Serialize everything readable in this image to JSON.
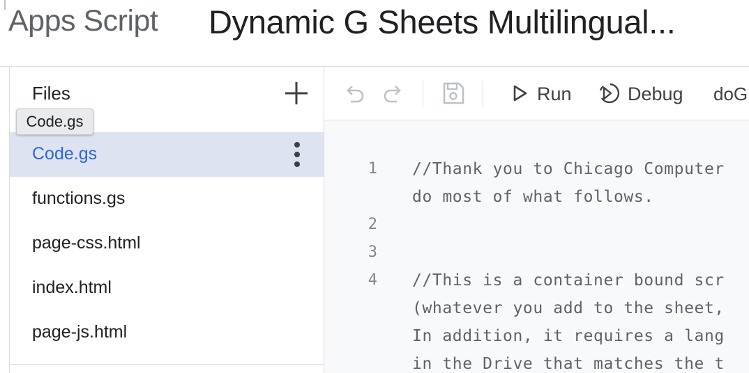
{
  "header": {
    "app_name": "Apps Script",
    "project_title": "Dynamic G Sheets Multilingual..."
  },
  "files": {
    "title": "Files",
    "tooltip": "Code.gs",
    "items": [
      {
        "label": "Code.gs",
        "active": true
      },
      {
        "label": "functions.gs"
      },
      {
        "label": "page-css.html"
      },
      {
        "label": "index.html"
      },
      {
        "label": "page-js.html"
      }
    ]
  },
  "toolbar": {
    "run_label": "Run",
    "debug_label": "Debug",
    "function_label": "doG"
  },
  "editor": {
    "line_numbers": [
      "1",
      "2",
      "3",
      "4"
    ],
    "lines": [
      "//Thank you to Chicago Computer",
      "do most of what follows.",
      "//This is a container bound scr",
      "(whatever you add to the sheet,",
      "In addition, it requires a lang",
      "in the Drive that matches the t"
    ]
  },
  "colors": {
    "accent": "#2f67d8",
    "selected_bg": "#dde3f1",
    "editor_bg": "#f8f9fa",
    "divider": "#dadce0"
  }
}
